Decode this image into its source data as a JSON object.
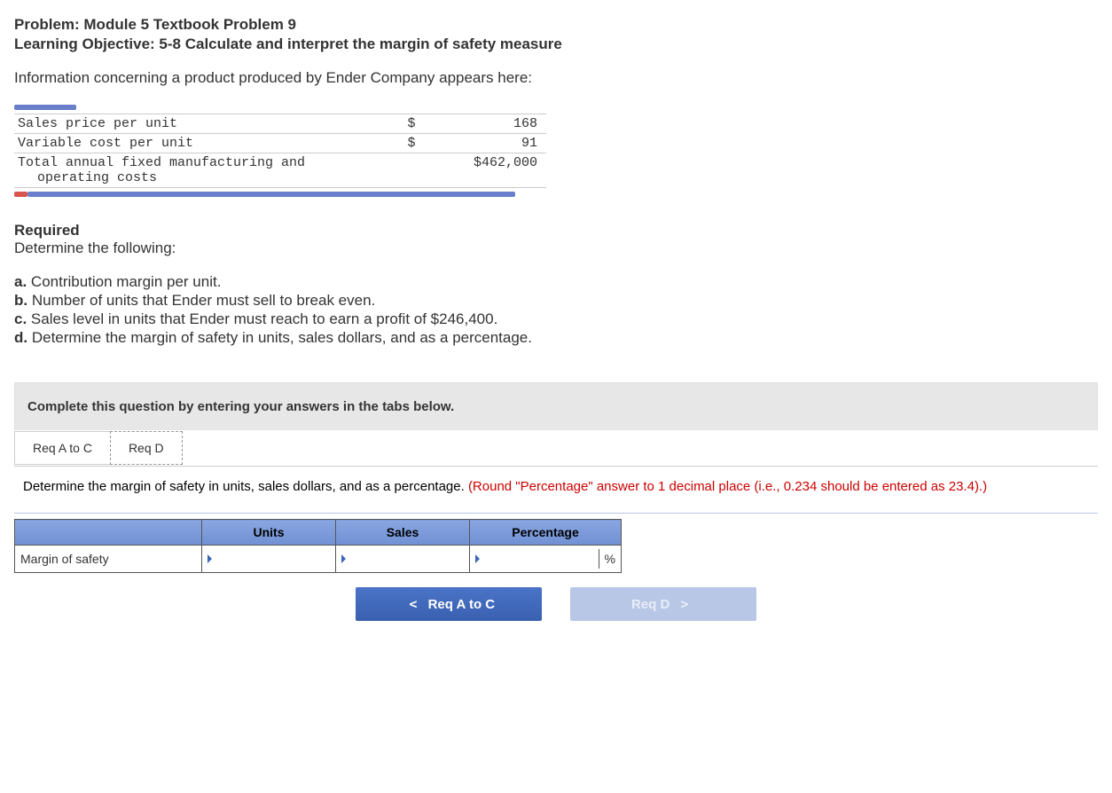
{
  "header": {
    "problem_line": "Problem: Module 5 Textbook Problem 9",
    "objective_line": "Learning Objective: 5-8 Calculate and interpret the margin of safety measure"
  },
  "intro": "Information concerning a product produced by Ender Company appears here:",
  "data_rows": [
    {
      "label": "Sales price per unit",
      "sym": "$",
      "value": "168"
    },
    {
      "label": "Variable cost per unit",
      "sym": "$",
      "value": "91"
    },
    {
      "label_line1": "Total annual fixed manufacturing and",
      "label_line2": "operating costs",
      "sym": "",
      "value": "$462,000"
    }
  ],
  "required": {
    "title": "Required",
    "subtitle": "Determine the following:",
    "items": [
      {
        "letter": "a.",
        "text": "Contribution margin per unit."
      },
      {
        "letter": "b.",
        "text": "Number of units that Ender must sell to break even."
      },
      {
        "letter": "c.",
        "text": "Sales level in units that Ender must reach to earn a profit of $246,400."
      },
      {
        "letter": "d.",
        "text": "Determine the margin of safety in units, sales dollars, and as a percentage."
      }
    ]
  },
  "answer_area": {
    "instruction": "Complete this question by entering your answers in the tabs below.",
    "tabs": [
      {
        "label": "Req A to C"
      },
      {
        "label": "Req D"
      }
    ],
    "active_tab_text_black": "Determine the margin of safety in units, sales dollars, and as a percentage. ",
    "active_tab_text_red": "(Round \"Percentage\" answer to 1 decimal place (i.e., 0.234 should be entered as 23.4).)",
    "columns": [
      "Units",
      "Sales",
      "Percentage"
    ],
    "row_label": "Margin of safety",
    "percent_suffix": "%"
  },
  "nav": {
    "prev_label": "Req A to C",
    "next_label": "Req D"
  }
}
